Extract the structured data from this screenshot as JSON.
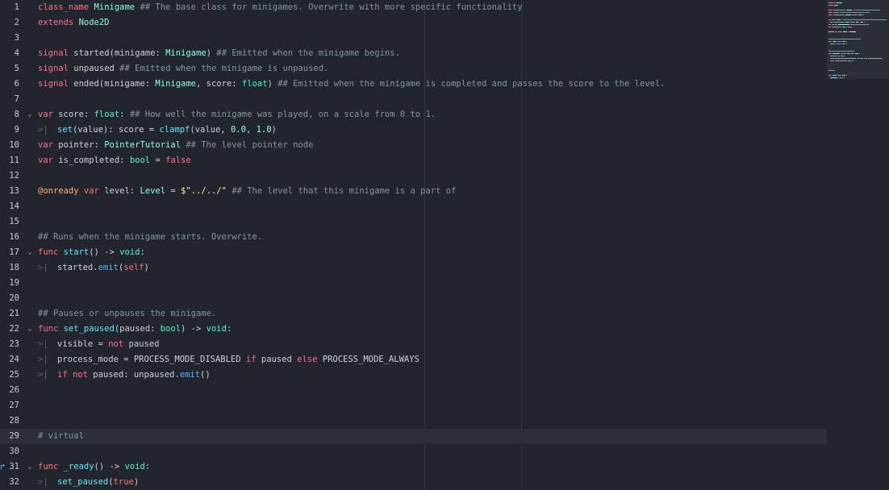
{
  "editor": {
    "lines": [
      {
        "n": "1",
        "fold": false,
        "tab": false,
        "tokens": [
          {
            "c": "kw",
            "t": "class_name "
          },
          {
            "c": "ty",
            "t": "Minigame "
          },
          {
            "c": "cm",
            "t": "## The base class for minigames. Overwrite with more specific functionality"
          }
        ]
      },
      {
        "n": "2",
        "fold": false,
        "tab": false,
        "tokens": [
          {
            "c": "kw",
            "t": "extends "
          },
          {
            "c": "ty",
            "t": "Node2D"
          }
        ]
      },
      {
        "n": "3",
        "fold": false,
        "tab": false,
        "tokens": []
      },
      {
        "n": "4",
        "fold": false,
        "tab": false,
        "tokens": [
          {
            "c": "kw",
            "t": "signal "
          },
          {
            "c": "pl",
            "t": "started(minigame: "
          },
          {
            "c": "ty",
            "t": "Minigame"
          },
          {
            "c": "pl",
            "t": ") "
          },
          {
            "c": "cm",
            "t": "## Emitted when the minigame begins."
          }
        ]
      },
      {
        "n": "5",
        "fold": false,
        "tab": false,
        "tokens": [
          {
            "c": "kw",
            "t": "signal "
          },
          {
            "c": "pl",
            "t": "unpaused "
          },
          {
            "c": "cm",
            "t": "## Emitted when the minigame is unpaused."
          }
        ]
      },
      {
        "n": "6",
        "fold": false,
        "tab": false,
        "tokens": [
          {
            "c": "kw",
            "t": "signal "
          },
          {
            "c": "pl",
            "t": "ended(minigame: "
          },
          {
            "c": "ty",
            "t": "Minigame"
          },
          {
            "c": "pl",
            "t": ", score: "
          },
          {
            "c": "ty2",
            "t": "float"
          },
          {
            "c": "pl",
            "t": ") "
          },
          {
            "c": "cm",
            "t": "## Emitted when the minigame is completed and passes the score to the level."
          }
        ]
      },
      {
        "n": "7",
        "fold": false,
        "tab": false,
        "tokens": []
      },
      {
        "n": "8",
        "fold": true,
        "tab": false,
        "tokens": [
          {
            "c": "kw",
            "t": "var "
          },
          {
            "c": "pl",
            "t": "score: "
          },
          {
            "c": "ty2",
            "t": "float"
          },
          {
            "c": "pl",
            "t": ": "
          },
          {
            "c": "cm",
            "t": "## How well the minigame was played, on a scale from 0 to 1."
          }
        ]
      },
      {
        "n": "9",
        "fold": false,
        "tab": true,
        "tokens": [
          {
            "c": "fn",
            "t": "set"
          },
          {
            "c": "pl",
            "t": "(value): score = "
          },
          {
            "c": "fn",
            "t": "clampf"
          },
          {
            "c": "pl",
            "t": "(value, "
          },
          {
            "c": "nu",
            "t": "0.0"
          },
          {
            "c": "pl",
            "t": ", "
          },
          {
            "c": "nu",
            "t": "1.0"
          },
          {
            "c": "pl",
            "t": ")"
          }
        ]
      },
      {
        "n": "10",
        "fold": false,
        "tab": false,
        "tokens": [
          {
            "c": "kw",
            "t": "var "
          },
          {
            "c": "pl",
            "t": "pointer: "
          },
          {
            "c": "ty",
            "t": "PointerTutorial "
          },
          {
            "c": "cm",
            "t": "## The level pointer node"
          }
        ]
      },
      {
        "n": "11",
        "fold": false,
        "tab": false,
        "tokens": [
          {
            "c": "kw",
            "t": "var "
          },
          {
            "c": "pl",
            "t": "is_completed: "
          },
          {
            "c": "ty2",
            "t": "bool"
          },
          {
            "c": "pl",
            "t": " = "
          },
          {
            "c": "kw",
            "t": "false"
          }
        ]
      },
      {
        "n": "12",
        "fold": false,
        "tab": false,
        "tokens": []
      },
      {
        "n": "13",
        "fold": false,
        "tab": false,
        "tokens": [
          {
            "c": "an",
            "t": "@onready "
          },
          {
            "c": "kw",
            "t": "var "
          },
          {
            "c": "pl",
            "t": "level: "
          },
          {
            "c": "ty",
            "t": "Level"
          },
          {
            "c": "pl",
            "t": " = "
          },
          {
            "c": "st",
            "t": "$\"../../\" "
          },
          {
            "c": "cm",
            "t": "## The level that this minigame is a part of"
          }
        ]
      },
      {
        "n": "14",
        "fold": false,
        "tab": false,
        "tokens": []
      },
      {
        "n": "15",
        "fold": false,
        "tab": false,
        "tokens": []
      },
      {
        "n": "16",
        "fold": false,
        "tab": false,
        "tokens": [
          {
            "c": "cm",
            "t": "## Runs when the minigame starts. Overwrite."
          }
        ]
      },
      {
        "n": "17",
        "fold": true,
        "tab": false,
        "tokens": [
          {
            "c": "kw",
            "t": "func "
          },
          {
            "c": "fn",
            "t": "start"
          },
          {
            "c": "pl",
            "t": "() -> "
          },
          {
            "c": "ty2",
            "t": "void"
          },
          {
            "c": "pl",
            "t": ":"
          }
        ]
      },
      {
        "n": "18",
        "fold": false,
        "tab": true,
        "tokens": [
          {
            "c": "pl",
            "t": "started."
          },
          {
            "c": "fn2",
            "t": "emit"
          },
          {
            "c": "pl",
            "t": "("
          },
          {
            "c": "kw",
            "t": "self"
          },
          {
            "c": "pl",
            "t": ")"
          }
        ]
      },
      {
        "n": "19",
        "fold": false,
        "tab": false,
        "tokens": []
      },
      {
        "n": "20",
        "fold": false,
        "tab": false,
        "tokens": []
      },
      {
        "n": "21",
        "fold": false,
        "tab": false,
        "tokens": [
          {
            "c": "cm",
            "t": "## Pauses or unpauses the minigame."
          }
        ]
      },
      {
        "n": "22",
        "fold": true,
        "tab": false,
        "tokens": [
          {
            "c": "kw",
            "t": "func "
          },
          {
            "c": "fn",
            "t": "set_paused"
          },
          {
            "c": "pl",
            "t": "(paused: "
          },
          {
            "c": "ty2",
            "t": "bool"
          },
          {
            "c": "pl",
            "t": ") -> "
          },
          {
            "c": "ty2",
            "t": "void"
          },
          {
            "c": "pl",
            "t": ":"
          }
        ]
      },
      {
        "n": "23",
        "fold": false,
        "tab": true,
        "tokens": [
          {
            "c": "pl",
            "t": "visible = "
          },
          {
            "c": "kw",
            "t": "not "
          },
          {
            "c": "pl",
            "t": "paused"
          }
        ]
      },
      {
        "n": "24",
        "fold": false,
        "tab": true,
        "tokens": [
          {
            "c": "pl",
            "t": "process_mode = PROCESS_MODE_DISABLED "
          },
          {
            "c": "kw",
            "t": "if "
          },
          {
            "c": "pl",
            "t": "paused "
          },
          {
            "c": "kw",
            "t": "else "
          },
          {
            "c": "pl",
            "t": "PROCESS_MODE_ALWAYS"
          }
        ]
      },
      {
        "n": "25",
        "fold": false,
        "tab": true,
        "tokens": [
          {
            "c": "kw",
            "t": "if not "
          },
          {
            "c": "pl",
            "t": "paused: unpaused."
          },
          {
            "c": "fn2",
            "t": "emit"
          },
          {
            "c": "pl",
            "t": "()"
          }
        ]
      },
      {
        "n": "26",
        "fold": false,
        "tab": false,
        "tokens": []
      },
      {
        "n": "27",
        "fold": false,
        "tab": false,
        "tokens": []
      },
      {
        "n": "28",
        "fold": false,
        "tab": false,
        "tokens": []
      },
      {
        "n": "29",
        "fold": false,
        "tab": false,
        "current": true,
        "tokens": [
          {
            "c": "cm",
            "t": "# virtual"
          }
        ]
      },
      {
        "n": "30",
        "fold": false,
        "tab": false,
        "tokens": []
      },
      {
        "n": "31",
        "fold": true,
        "tab": false,
        "exec": true,
        "tokens": [
          {
            "c": "kw",
            "t": "func "
          },
          {
            "c": "fn",
            "t": "_ready"
          },
          {
            "c": "pl",
            "t": "() -> "
          },
          {
            "c": "ty2",
            "t": "void"
          },
          {
            "c": "pl",
            "t": ":"
          }
        ]
      },
      {
        "n": "32",
        "fold": false,
        "tab": true,
        "tokens": [
          {
            "c": "fn",
            "t": "set_paused"
          },
          {
            "c": "pl",
            "t": "("
          },
          {
            "c": "kw",
            "t": "true"
          },
          {
            "c": "pl",
            "t": ")"
          }
        ]
      }
    ]
  },
  "icons": {
    "fold": "chevron-down-icon",
    "tab": "tab-indent-icon",
    "exec": "override-arrow-icon"
  },
  "colors": {
    "background": "#21252d",
    "keyword": "#ff7085",
    "type": "#8effda",
    "function": "#66e6ff",
    "comment": "#8c939d",
    "string": "#ffeda1",
    "annotation": "#ffb373",
    "number": "#a1ffe0"
  }
}
